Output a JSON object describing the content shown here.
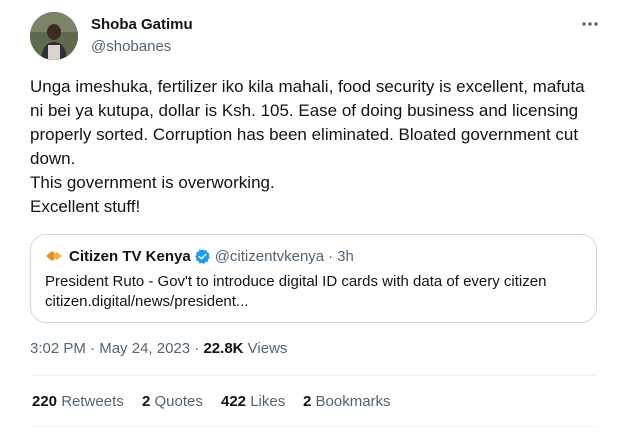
{
  "author": {
    "name": "Shoba Gatimu",
    "handle": "@shobanes"
  },
  "more_icon": "ellipsis-icon",
  "tweet_text": "Unga imeshuka, fertilizer iko kila mahali, food security is excellent, mafuta ni bei ya kutupa, dollar is Ksh. 105. Ease of doing business and licensing properly sorted. Corruption has been eliminated. Bloated government cut down.\nThis government is overworking.\nExcellent stuff!",
  "quote": {
    "author_name": "Citizen TV Kenya",
    "author_handle": "@citizentvkenya",
    "separator": "·",
    "time": "3h",
    "verified_color": "#1d9bf0",
    "text_line1": "President Ruto - Gov't to introduce digital ID cards with data of every citizen",
    "text_line2": "citizen.digital/news/president..."
  },
  "meta": {
    "time": "3:02 PM",
    "separator1": "·",
    "date": "May 24, 2023",
    "separator2": "·",
    "views_count": "22.8K",
    "views_label": "Views"
  },
  "stats": {
    "retweets_count": "220",
    "retweets_label": "Retweets",
    "quotes_count": "2",
    "quotes_label": "Quotes",
    "likes_count": "422",
    "likes_label": "Likes",
    "bookmarks_count": "2",
    "bookmarks_label": "Bookmarks"
  }
}
